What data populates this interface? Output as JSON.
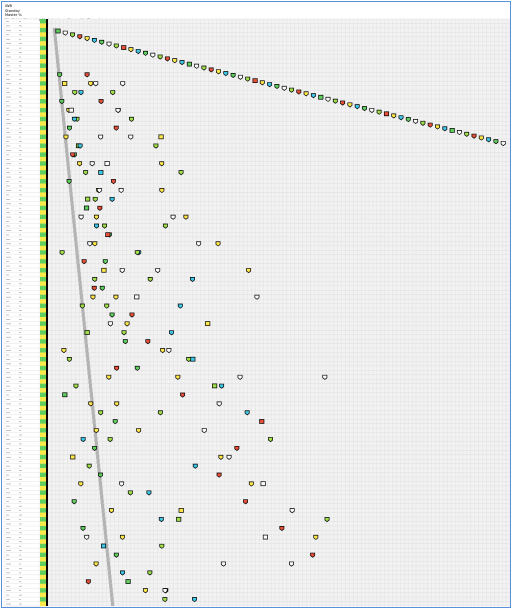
{
  "header": {
    "line1": "iWB",
    "line2": "Standby",
    "line3": "Master %",
    "line4": "Big Table: Threaded Module clone. Re-quality Threads"
  },
  "grid": {
    "row_count": 132,
    "column_count": 118,
    "row_label_sample": [
      "1",
      "2",
      "3",
      "4",
      "5"
    ]
  },
  "colors": {
    "frame": "#5b8fd6",
    "grid_line": "#d9d9d9",
    "cell_fill": "#f2f2f2",
    "gray_bar": "#b3b3b3",
    "marker_outline": "#000000",
    "palette": [
      "#5fcf5f",
      "#3ec8e8",
      "#ffe84a",
      "#e8503a",
      "#a0e04a",
      "#ffffff"
    ]
  },
  "markers": {
    "legend_note": "",
    "shape_names": [
      "diamond-marker",
      "square-marker"
    ]
  }
}
